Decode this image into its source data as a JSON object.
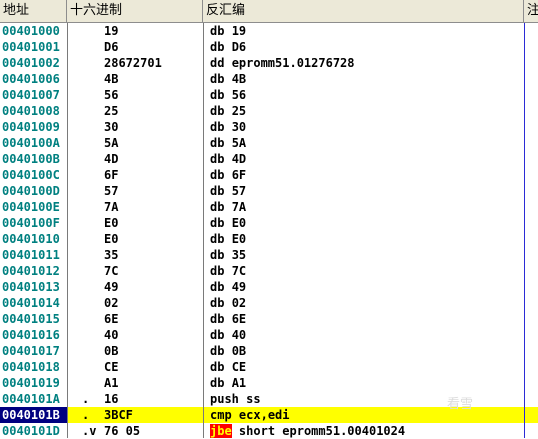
{
  "header": {
    "address": "地址",
    "hex": "十六进制",
    "disassembly": "反汇编",
    "comment": "注"
  },
  "rows": [
    {
      "address": "00401000",
      "mark": "",
      "hex": "19",
      "mnemonic": "db",
      "operand": "19"
    },
    {
      "address": "00401001",
      "mark": "",
      "hex": "D6",
      "mnemonic": "db",
      "operand": "D6"
    },
    {
      "address": "00401002",
      "mark": "",
      "hex": "28672701",
      "mnemonic": "dd",
      "operand": "epromm51.01276728"
    },
    {
      "address": "00401006",
      "mark": "",
      "hex": "4B",
      "mnemonic": "db",
      "operand": "4B"
    },
    {
      "address": "00401007",
      "mark": "",
      "hex": "56",
      "mnemonic": "db",
      "operand": "56"
    },
    {
      "address": "00401008",
      "mark": "",
      "hex": "25",
      "mnemonic": "db",
      "operand": "25"
    },
    {
      "address": "00401009",
      "mark": "",
      "hex": "30",
      "mnemonic": "db",
      "operand": "30"
    },
    {
      "address": "0040100A",
      "mark": "",
      "hex": "5A",
      "mnemonic": "db",
      "operand": "5A"
    },
    {
      "address": "0040100B",
      "mark": "",
      "hex": "4D",
      "mnemonic": "db",
      "operand": "4D"
    },
    {
      "address": "0040100C",
      "mark": "",
      "hex": "6F",
      "mnemonic": "db",
      "operand": "6F"
    },
    {
      "address": "0040100D",
      "mark": "",
      "hex": "57",
      "mnemonic": "db",
      "operand": "57"
    },
    {
      "address": "0040100E",
      "mark": "",
      "hex": "7A",
      "mnemonic": "db",
      "operand": "7A"
    },
    {
      "address": "0040100F",
      "mark": "",
      "hex": "E0",
      "mnemonic": "db",
      "operand": "E0"
    },
    {
      "address": "00401010",
      "mark": "",
      "hex": "E0",
      "mnemonic": "db",
      "operand": "E0"
    },
    {
      "address": "00401011",
      "mark": "",
      "hex": "35",
      "mnemonic": "db",
      "operand": "35"
    },
    {
      "address": "00401012",
      "mark": "",
      "hex": "7C",
      "mnemonic": "db",
      "operand": "7C"
    },
    {
      "address": "00401013",
      "mark": "",
      "hex": "49",
      "mnemonic": "db",
      "operand": "49"
    },
    {
      "address": "00401014",
      "mark": "",
      "hex": "02",
      "mnemonic": "db",
      "operand": "02"
    },
    {
      "address": "00401015",
      "mark": "",
      "hex": "6E",
      "mnemonic": "db",
      "operand": "6E"
    },
    {
      "address": "00401016",
      "mark": "",
      "hex": "40",
      "mnemonic": "db",
      "operand": "40"
    },
    {
      "address": "00401017",
      "mark": "",
      "hex": "0B",
      "mnemonic": "db",
      "operand": "0B"
    },
    {
      "address": "00401018",
      "mark": "",
      "hex": "CE",
      "mnemonic": "db",
      "operand": "CE"
    },
    {
      "address": "00401019",
      "mark": "",
      "hex": "A1",
      "mnemonic": "db",
      "operand": "A1"
    },
    {
      "address": "0040101A",
      "mark": ".",
      "hex": "16",
      "mnemonic": "push",
      "operand": "ss"
    },
    {
      "address": "0040101B",
      "mark": ".",
      "hex": "3BCF",
      "mnemonic": "cmp",
      "operand": "ecx,edi"
    },
    {
      "address": "0040101D",
      "mark": ".v",
      "hex": "76 05",
      "mnemonic": "jbe",
      "operand": "short epromm51.00401024"
    }
  ],
  "selected_index": 24,
  "highlighted_index": 24,
  "jump_index": 25,
  "watermark": "看雪",
  "colors": {
    "address": "#008080",
    "selection": "#000080",
    "highlight": "#ffff00",
    "jump_bg": "#ff0000",
    "jump_fg": "#ffff00",
    "header_bg": "#ece9d8",
    "column_separator": "#2b2bd6"
  }
}
